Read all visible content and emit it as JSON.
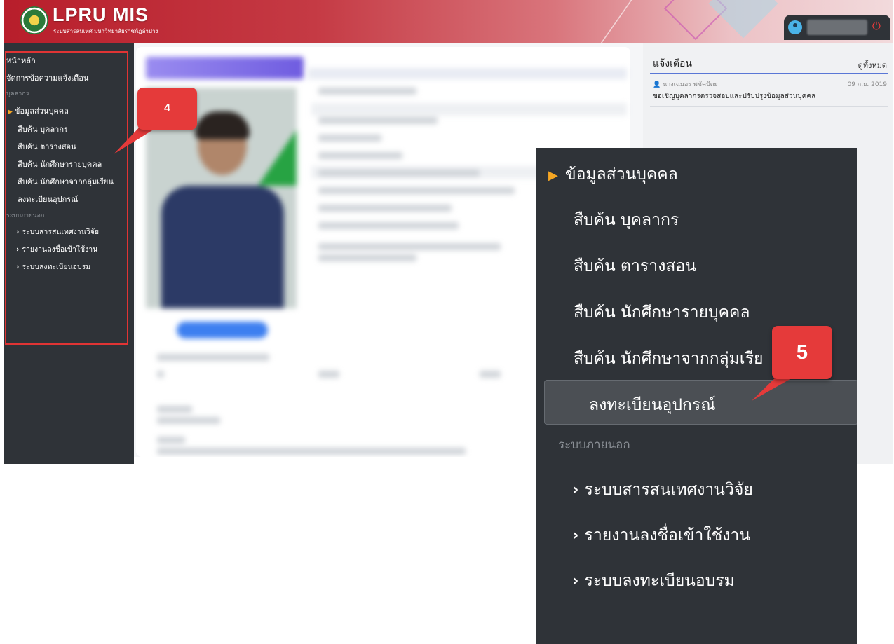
{
  "header": {
    "title": "LPRU MIS",
    "subtitle": "ระบบสารสนเทศ มหาวิทยาลัยราชภัฏลำปาง",
    "power_icon": "power-icon",
    "avatar_icon": "user-avatar-icon"
  },
  "sidebar": {
    "items": [
      {
        "label": "หน้าหลัก"
      },
      {
        "label": "จัดการข้อความแจ้งเตือน"
      }
    ],
    "section_personnel": "บุคลากร",
    "personnel_items": [
      {
        "label": "ข้อมูลส่วนบุคคล"
      },
      {
        "label": "สืบค้น บุคลากร"
      },
      {
        "label": "สืบค้น ตารางสอน"
      },
      {
        "label": "สืบค้น นักศึกษารายบุคคล"
      },
      {
        "label": "สืบค้น นักศึกษาจากกลุ่มเรียน"
      },
      {
        "label": "ลงทะเบียนอุปกรณ์"
      }
    ],
    "section_external": "ระบบภายนอก",
    "external_items": [
      {
        "label": "ระบบสารสนเทศงานวิจัย"
      },
      {
        "label": "รายงานลงชื่อเข้าใช้งาน"
      },
      {
        "label": "ระบบลงทะเบียนอบรม"
      }
    ]
  },
  "notice": {
    "title": "แจ้งเตือน",
    "view_all": "ดูทั้งหมด",
    "author": "นางเฉมอร พชัคปัดย",
    "date": "09 ก.ย. 2019",
    "message": "ขอเชิญบุคลากรตรวจสอบและปรับปรุงข้อมูลส่วนบุคคล"
  },
  "callouts": {
    "step4": "4",
    "step5": "5"
  },
  "zoom_menu": {
    "items": [
      {
        "label": "ข้อมูลส่วนบุคคล"
      },
      {
        "label": "สืบค้น บุคลากร"
      },
      {
        "label": "สืบค้น ตารางสอน"
      },
      {
        "label": "สืบค้น นักศึกษารายบุคคล"
      },
      {
        "label": "สืบค้น นักศึกษาจากกลุ่มเรีย"
      },
      {
        "label": "ลงทะเบียนอุปกรณ์"
      }
    ],
    "section": "ระบบภายนอก",
    "external_items": [
      {
        "label": "ระบบสารสนเทศงานวิจัย"
      },
      {
        "label": "รายงานลงชื่อเข้าใช้งาน"
      },
      {
        "label": "ระบบลงทะเบียนอบรม"
      }
    ]
  },
  "colors": {
    "header_red": "#b81e2b",
    "sidebar_bg": "#2f3338",
    "accent_orange": "#f5a623",
    "callout_red": "#e53a3a",
    "notice_rule": "#5a77d6"
  }
}
